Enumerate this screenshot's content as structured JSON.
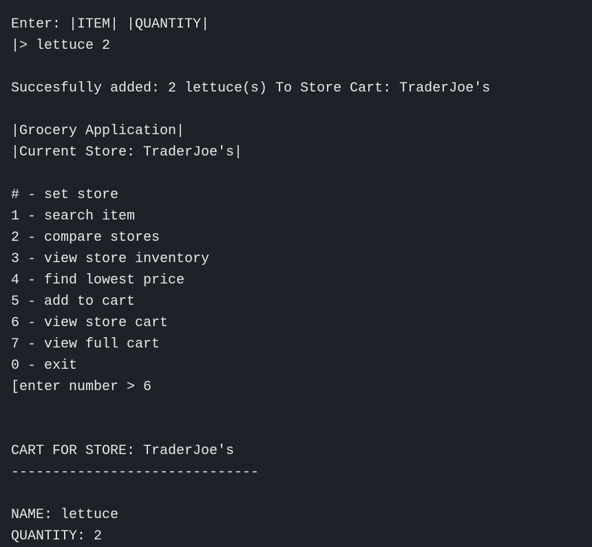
{
  "terminal": {
    "lines": [
      {
        "id": "prompt-hint",
        "text": "Enter: |ITEM| |QUANTITY|"
      },
      {
        "id": "user-input",
        "text": "|> lettuce 2"
      },
      {
        "id": "blank-1",
        "text": ""
      },
      {
        "id": "success-msg",
        "text": "Succesfully added: 2 lettuce(s) To Store Cart: TraderJoe's"
      },
      {
        "id": "blank-2",
        "text": ""
      },
      {
        "id": "app-title",
        "text": "|Grocery Application|"
      },
      {
        "id": "current-store",
        "text": "|Current Store: TraderJoe's|"
      },
      {
        "id": "blank-3",
        "text": ""
      },
      {
        "id": "menu-hash",
        "text": "# - set store"
      },
      {
        "id": "menu-1",
        "text": "1 - search item"
      },
      {
        "id": "menu-2",
        "text": "2 - compare stores"
      },
      {
        "id": "menu-3",
        "text": "3 - view store inventory"
      },
      {
        "id": "menu-4",
        "text": "4 - find lowest price"
      },
      {
        "id": "menu-5",
        "text": "5 - add to cart"
      },
      {
        "id": "menu-6",
        "text": "6 - view store cart"
      },
      {
        "id": "menu-7",
        "text": "7 - view full cart"
      },
      {
        "id": "menu-0",
        "text": "0 - exit"
      },
      {
        "id": "menu-prompt",
        "text": "[enter number > 6"
      },
      {
        "id": "blank-4",
        "text": ""
      },
      {
        "id": "blank-5",
        "text": ""
      },
      {
        "id": "cart-header",
        "text": "CART FOR STORE: TraderJoe's"
      },
      {
        "id": "cart-divider",
        "text": "------------------------------"
      },
      {
        "id": "blank-6",
        "text": ""
      },
      {
        "id": "cart-name",
        "text": "NAME: lettuce"
      },
      {
        "id": "cart-qty",
        "text": "QUANTITY: 2"
      }
    ]
  }
}
